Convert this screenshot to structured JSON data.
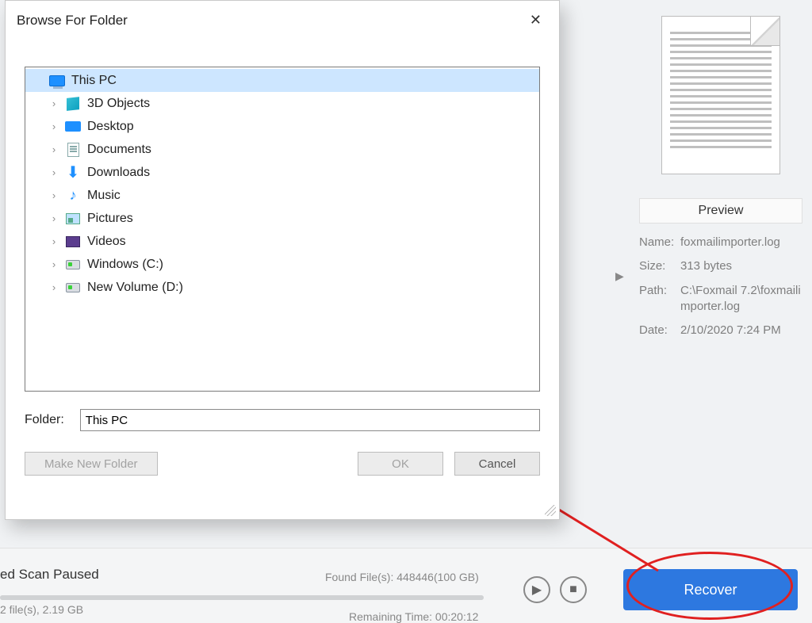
{
  "dialog": {
    "title": "Browse For Folder",
    "tree": {
      "root": "This PC",
      "items": [
        "3D Objects",
        "Desktop",
        "Documents",
        "Downloads",
        "Music",
        "Pictures",
        "Videos",
        "Windows (C:)",
        "New Volume (D:)"
      ]
    },
    "folder_label": "Folder:",
    "folder_value": "This PC",
    "make_new_label": "Make New Folder",
    "ok_label": "OK",
    "cancel_label": "Cancel"
  },
  "preview": {
    "header": "Preview",
    "name_k": "Name:",
    "name_v": "foxmailimporter.log",
    "size_k": "Size:",
    "size_v": "313 bytes",
    "path_k": "Path:",
    "path_v": "C:\\Foxmail 7.2\\foxmailimporter.log",
    "date_k": "Date:",
    "date_v": "2/10/2020 7:24 PM"
  },
  "status": {
    "scan_state": "ed Scan Paused",
    "found": "Found File(s):  448446(100 GB)",
    "selected": "2 file(s), 2.19 GB",
    "remaining": "Remaining Time:  00:20:12",
    "recover_label": "Recover"
  }
}
